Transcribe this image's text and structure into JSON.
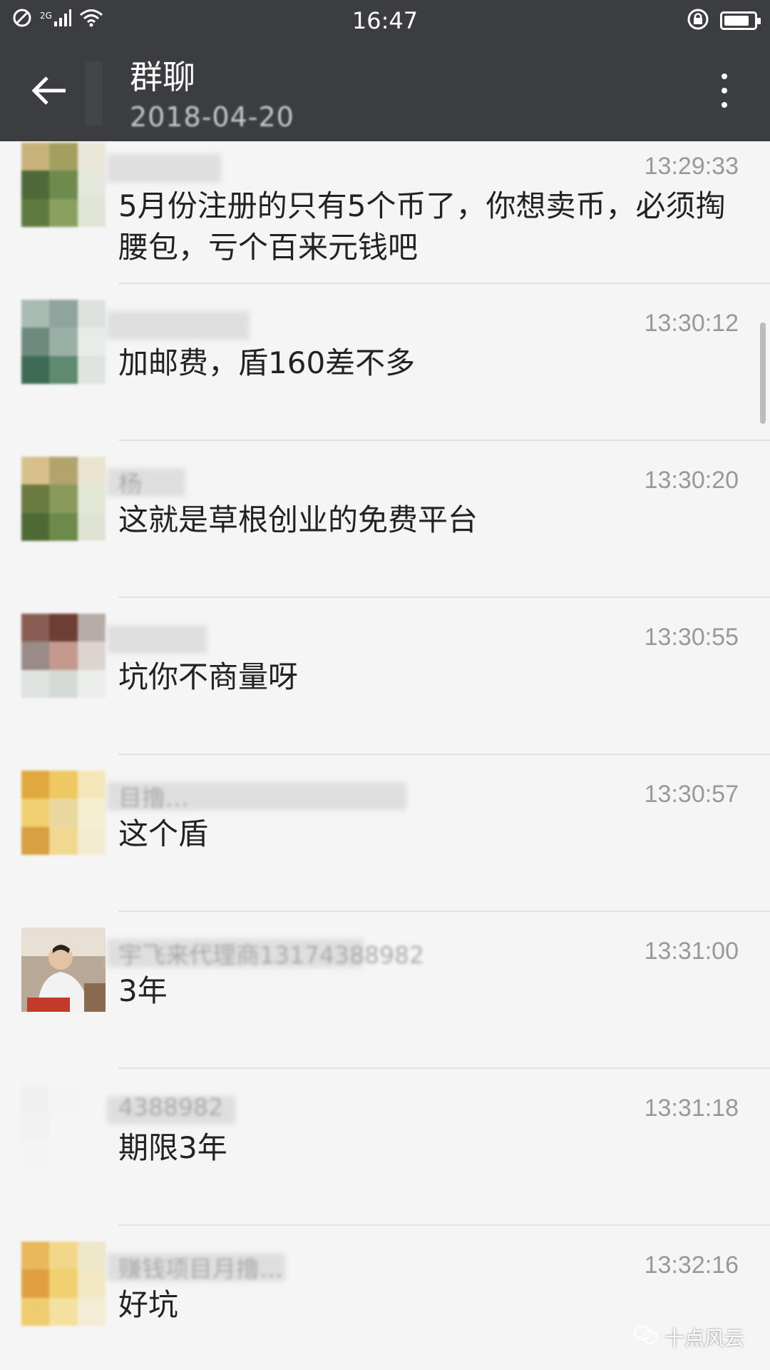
{
  "status_bar": {
    "time": "16:47",
    "network_label": "2G",
    "icons": [
      "blocked-icon",
      "signal-icon",
      "wifi-icon",
      "lock-rotation-icon",
      "battery-icon"
    ],
    "battery_level": 0.85
  },
  "toolbar": {
    "title": "群聊",
    "subtitle": "2018-04-20"
  },
  "messages": [
    {
      "sender": "",
      "time": "13:29:33",
      "text": "5月份注册的只有5个币了，你想卖币，必须掏腰包，亏个百来元钱吧"
    },
    {
      "sender": "",
      "time": "13:30:12",
      "text": "加邮费，盾160差不多"
    },
    {
      "sender": "杨",
      "time": "13:30:20",
      "text": "这就是草根创业的免费平台"
    },
    {
      "sender": "",
      "time": "13:30:55",
      "text": "坑你不商量呀"
    },
    {
      "sender": "目撸…",
      "time": "13:30:57",
      "text": "这个盾"
    },
    {
      "sender": "宇飞来代理商13174388982",
      "time": "13:31:00",
      "text": "3年"
    },
    {
      "sender": "4388982",
      "time": "13:31:18",
      "text": "期限3年"
    },
    {
      "sender": "赚钱项目月撸…",
      "time": "13:32:16",
      "text": "好坑"
    }
  ],
  "watermark": {
    "text": "十点风云"
  },
  "colors": {
    "toolbar_bg": "#3b3d40",
    "list_bg": "#f5f5f5",
    "time_text": "#999999"
  }
}
